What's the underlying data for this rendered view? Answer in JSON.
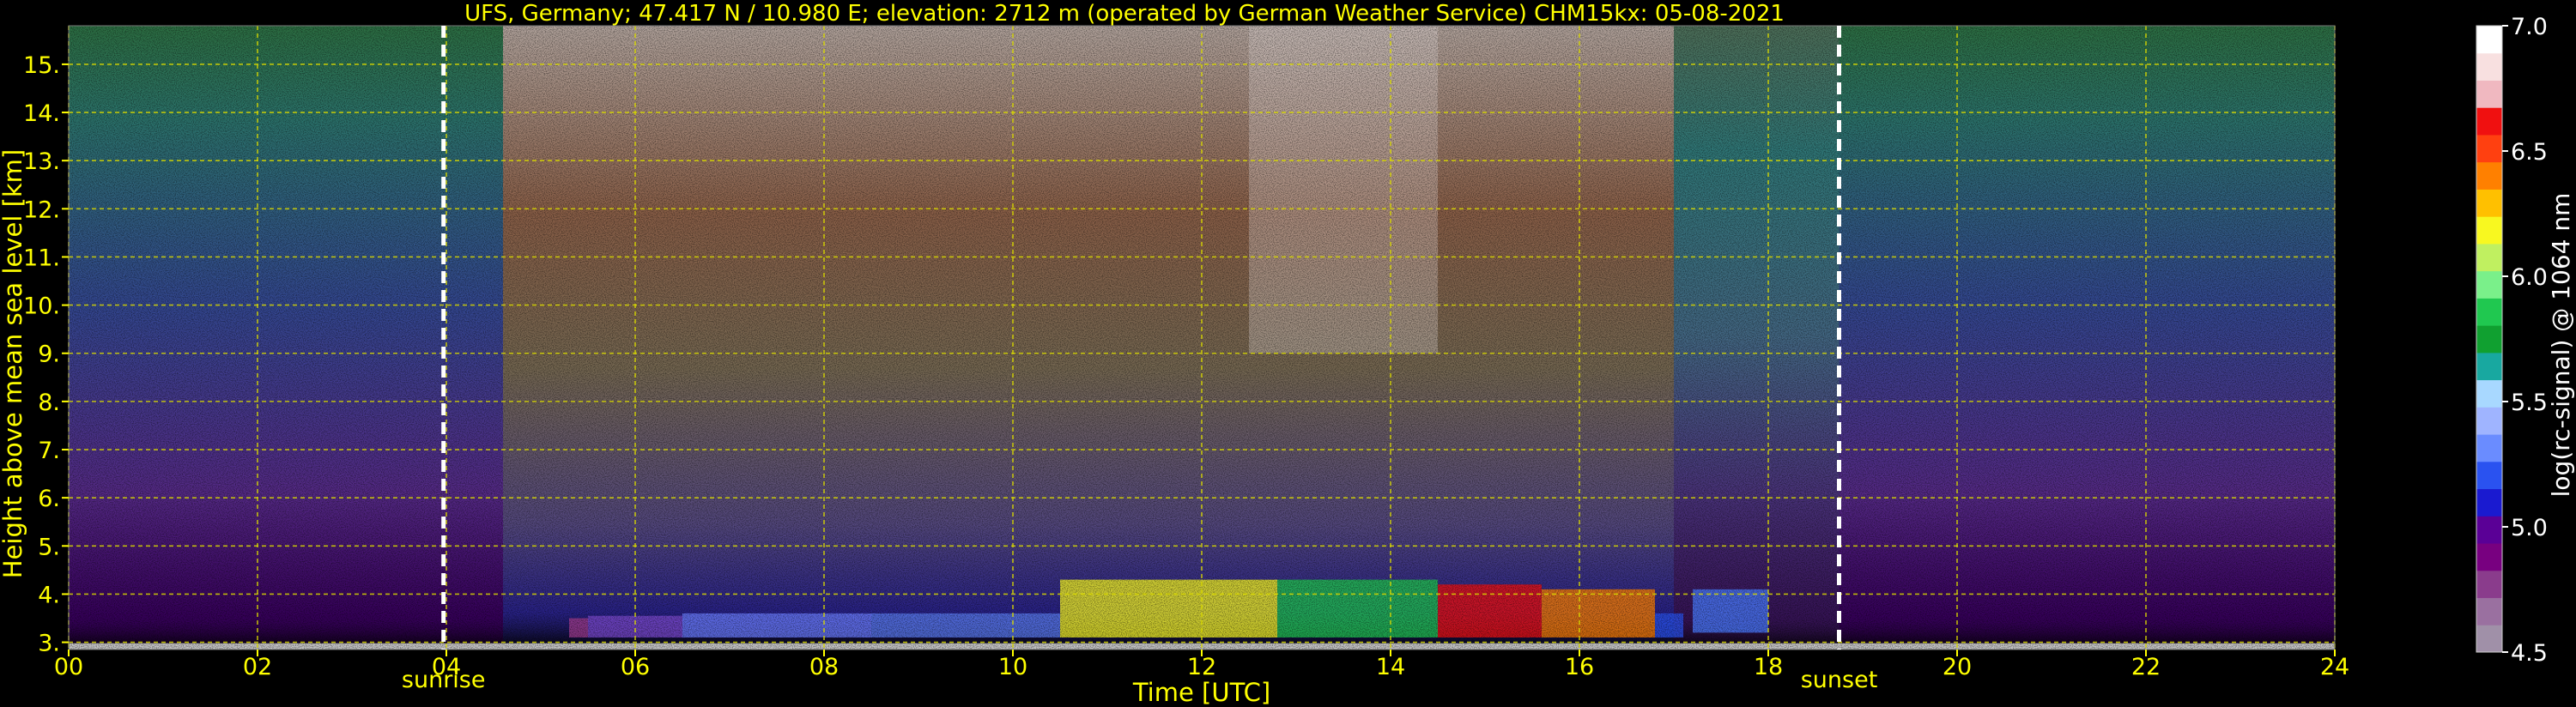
{
  "chart_data": {
    "type": "heatmap",
    "title": "UFS, Germany; 47.417 N / 10.980 E; elevation: 2712 m  (operated by German Weather Service)    CHM15kx: 05-08-2021",
    "xlabel": "Time [UTC]",
    "ylabel": "Height above mean sea level [km]",
    "xlim": [
      0,
      24
    ],
    "ylim": [
      2.85,
      15.8
    ],
    "x_ticks": [
      "00",
      "02",
      "04",
      "06",
      "08",
      "10",
      "12",
      "14",
      "16",
      "18",
      "20",
      "22",
      "24"
    ],
    "y_ticks": [
      "3.",
      "4.",
      "5.",
      "6.",
      "7.",
      "8.",
      "9.",
      "10.",
      "11.",
      "12.",
      "13.",
      "14.",
      "15."
    ],
    "grid": true,
    "grid_style": "dashed yellow",
    "markers": [
      {
        "label": "sunrise",
        "time": 3.97
      },
      {
        "label": "sunset",
        "time": 18.75
      }
    ],
    "colorbar": {
      "label": "log(rc-signal) @ 1064 nm",
      "range": [
        4.5,
        7.0
      ],
      "ticks": [
        "4.5",
        "5.0",
        "5.5",
        "6.0",
        "6.5",
        "7.0"
      ],
      "colors": [
        "#a090a8",
        "#9a70a0",
        "#8a3c8c",
        "#780080",
        "#5a0096",
        "#1a1ad0",
        "#2a52f0",
        "#6a8cff",
        "#9fb4ff",
        "#a8d8ff",
        "#18a8a0",
        "#10a030",
        "#20c850",
        "#7af08a",
        "#c0f060",
        "#f8f820",
        "#ffc000",
        "#ff8000",
        "#ff4010",
        "#f01010",
        "#f0b8c0",
        "#f8e0e0",
        "#ffffff"
      ]
    },
    "colors": {
      "text": "#ffff00",
      "grid": "#d8d800",
      "background": "#000000",
      "markers": "#ffffff"
    }
  }
}
